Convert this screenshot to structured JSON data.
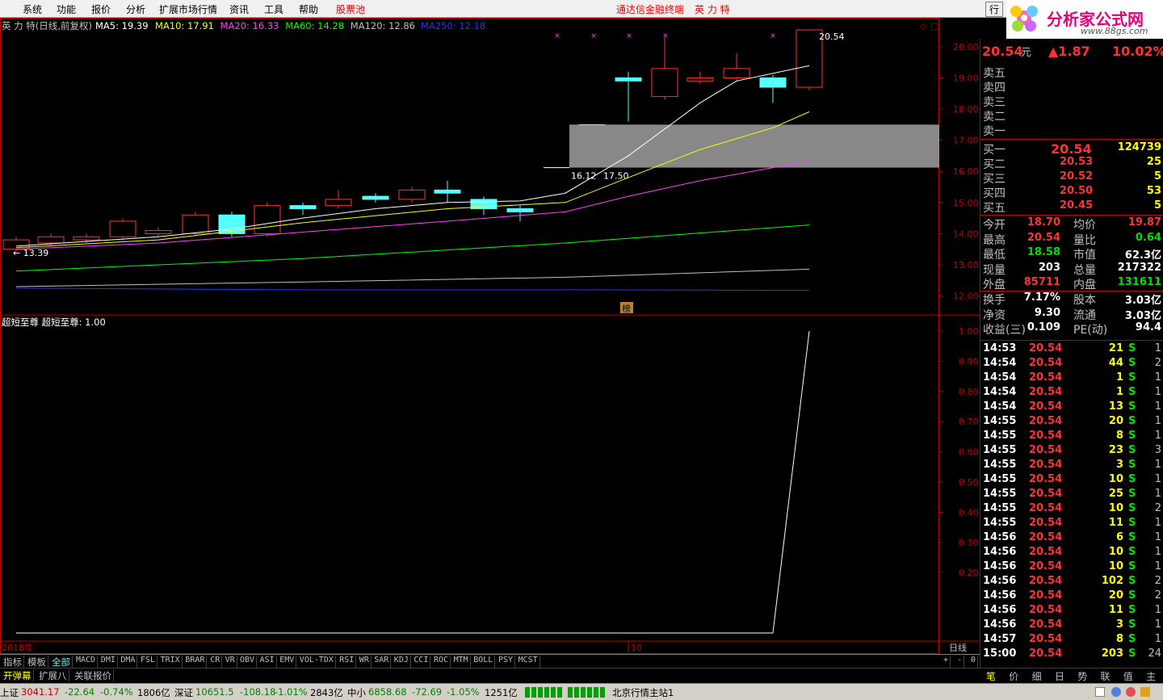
{
  "menu": {
    "items": [
      "系统",
      "功能",
      "报价",
      "分析",
      "扩展市场行情",
      "资讯",
      "工具",
      "帮助"
    ],
    "pool": "股票池",
    "center_title": "通达信金融终端",
    "stock_name": "英 力 特",
    "right_btn": "行"
  },
  "logo": {
    "title": "分析家公式网",
    "url": "www.88gs.com"
  },
  "chart": {
    "header_name": "英 力 特(日线,前复权)",
    "ma": [
      {
        "label": "MA5: 19.39",
        "color": "#ffffff"
      },
      {
        "label": "MA10: 17.91",
        "color": "#ffff00"
      },
      {
        "label": "MA20: 16.33",
        "color": "#ff40ff"
      },
      {
        "label": "MA60: 14.28",
        "color": "#00ff00"
      },
      {
        "label": "MA120: 12.86",
        "color": "#c0c0c0"
      },
      {
        "label": "MA250: 12.18",
        "color": "#3030ff"
      }
    ],
    "price_ticks": [
      "20.00",
      "19.00",
      "18.00",
      "17.00",
      "16.00",
      "15.00",
      "14.00",
      "13.00",
      "12.00"
    ],
    "high_label": "20.54",
    "low_label": "13.39",
    "gap_low": "16.12",
    "gap_high": "17.50",
    "badge": "榜",
    "indicator_header": "超短至尊 超短至尊: 1.00",
    "ind_ticks": [
      "1.00",
      "0.90",
      "0.80",
      "0.70",
      "0.60",
      "0.50",
      "0.40",
      "0.30",
      "0.20"
    ],
    "year_label": "2018年",
    "month_label": "10",
    "period_label": "日线"
  },
  "chart_data": {
    "type": "candlestick",
    "candles": [
      {
        "o": 13.5,
        "c": 13.8,
        "h": 13.9,
        "l": 13.4
      },
      {
        "o": 13.7,
        "c": 13.9,
        "h": 14.0,
        "l": 13.6
      },
      {
        "o": 13.8,
        "c": 13.9,
        "h": 14.0,
        "l": 13.7
      },
      {
        "o": 13.9,
        "c": 14.4,
        "h": 14.5,
        "l": 13.8
      },
      {
        "o": 14.0,
        "c": 14.1,
        "h": 14.2,
        "l": 13.9
      },
      {
        "o": 14.0,
        "c": 14.6,
        "h": 14.7,
        "l": 13.9
      },
      {
        "o": 14.6,
        "c": 14.0,
        "h": 14.7,
        "l": 13.9
      },
      {
        "o": 14.0,
        "c": 14.9,
        "h": 15.0,
        "l": 13.9
      },
      {
        "o": 14.9,
        "c": 14.8,
        "h": 15.0,
        "l": 14.6
      },
      {
        "o": 14.9,
        "c": 15.1,
        "h": 15.4,
        "l": 14.8
      },
      {
        "o": 15.2,
        "c": 15.1,
        "h": 15.3,
        "l": 15.0
      },
      {
        "o": 15.1,
        "c": 15.4,
        "h": 15.5,
        "l": 15.0
      },
      {
        "o": 15.4,
        "c": 15.3,
        "h": 15.7,
        "l": 15.0
      },
      {
        "o": 15.1,
        "c": 14.8,
        "h": 15.2,
        "l": 14.6
      },
      {
        "o": 14.8,
        "c": 14.7,
        "h": 14.9,
        "l": 14.4
      },
      null,
      {
        "o": 16.12,
        "c": 16.12,
        "h": 16.12,
        "l": 16.12
      },
      {
        "o": 17.5,
        "c": 17.5,
        "h": 17.5,
        "l": 17.5
      },
      {
        "o": 19.0,
        "c": 18.9,
        "h": 19.2,
        "l": 17.6
      },
      {
        "o": 18.4,
        "c": 19.3,
        "h": 20.3,
        "l": 18.3
      },
      {
        "o": 18.9,
        "c": 19.0,
        "h": 19.2,
        "l": 18.8
      },
      {
        "o": 19.0,
        "c": 19.3,
        "h": 19.8,
        "l": 18.9
      },
      {
        "o": 19.0,
        "c": 18.7,
        "h": 19.1,
        "l": 18.2
      },
      {
        "o": 18.7,
        "c": 20.54,
        "h": 20.54,
        "l": 18.6
      }
    ],
    "gap": {
      "low": 16.12,
      "high": 17.5
    },
    "ylim": [
      11.6,
      20.8
    ],
    "indicator": {
      "values_flat": 0.0,
      "end_value": 1.0
    }
  },
  "quote": {
    "price": "20.54",
    "unit": "元",
    "change": "▲1.87",
    "pct": "10.02%",
    "sell": [
      "卖五",
      "卖四",
      "卖三",
      "卖二",
      "卖一"
    ],
    "buy": [
      {
        "label": "买一",
        "price": "20.54",
        "vol": "124739"
      },
      {
        "label": "买二",
        "price": "20.53",
        "vol": "25"
      },
      {
        "label": "买三",
        "price": "20.52",
        "vol": "5"
      },
      {
        "label": "买四",
        "price": "20.50",
        "vol": "53"
      },
      {
        "label": "买五",
        "price": "20.45",
        "vol": "5"
      }
    ],
    "stats": [
      {
        "l1": "今开",
        "v1": "18.70",
        "c1": "red",
        "l2": "均价",
        "v2": "19.87",
        "c2": "red"
      },
      {
        "l1": "最高",
        "v1": "20.54",
        "c1": "red",
        "l2": "量比",
        "v2": "0.64",
        "c2": "grn"
      },
      {
        "l1": "最低",
        "v1": "18.58",
        "c1": "grn",
        "l2": "市值",
        "v2": "62.3亿",
        "c2": "wht"
      },
      {
        "l1": "现量",
        "v1": "203",
        "c1": "wht",
        "l2": "总量",
        "v2": "217322",
        "c2": "wht"
      },
      {
        "l1": "外盘",
        "v1": "85711",
        "c1": "red",
        "l2": "内盘",
        "v2": "131611",
        "c2": "grn"
      },
      {
        "l1": "换手",
        "v1": "7.17%",
        "c1": "wht",
        "l2": "股本",
        "v2": "3.03亿",
        "c2": "wht"
      },
      {
        "l1": "净资",
        "v1": "9.30",
        "c1": "wht",
        "l2": "流通",
        "v2": "3.03亿",
        "c2": "wht"
      },
      {
        "l1": "收益(三)",
        "v1": "0.109",
        "c1": "wht",
        "l2": "PE(动)",
        "v2": "94.4",
        "c2": "wht"
      }
    ],
    "ticks": [
      {
        "t": "14:53",
        "p": "20.54",
        "v": "21",
        "n": "1"
      },
      {
        "t": "14:54",
        "p": "20.54",
        "v": "44",
        "n": "2"
      },
      {
        "t": "14:54",
        "p": "20.54",
        "v": "1",
        "n": "1"
      },
      {
        "t": "14:54",
        "p": "20.54",
        "v": "1",
        "n": "1"
      },
      {
        "t": "14:54",
        "p": "20.54",
        "v": "13",
        "n": "1"
      },
      {
        "t": "14:55",
        "p": "20.54",
        "v": "20",
        "n": "1"
      },
      {
        "t": "14:55",
        "p": "20.54",
        "v": "8",
        "n": "1"
      },
      {
        "t": "14:55",
        "p": "20.54",
        "v": "23",
        "n": "3"
      },
      {
        "t": "14:55",
        "p": "20.54",
        "v": "3",
        "n": "1"
      },
      {
        "t": "14:55",
        "p": "20.54",
        "v": "10",
        "n": "1"
      },
      {
        "t": "14:55",
        "p": "20.54",
        "v": "25",
        "n": "1"
      },
      {
        "t": "14:55",
        "p": "20.54",
        "v": "10",
        "n": "2"
      },
      {
        "t": "14:55",
        "p": "20.54",
        "v": "11",
        "n": "1"
      },
      {
        "t": "14:56",
        "p": "20.54",
        "v": "6",
        "n": "1"
      },
      {
        "t": "14:56",
        "p": "20.54",
        "v": "10",
        "n": "1"
      },
      {
        "t": "14:56",
        "p": "20.54",
        "v": "10",
        "n": "1"
      },
      {
        "t": "14:56",
        "p": "20.54",
        "v": "102",
        "n": "2"
      },
      {
        "t": "14:56",
        "p": "20.54",
        "v": "20",
        "n": "2"
      },
      {
        "t": "14:56",
        "p": "20.54",
        "v": "11",
        "n": "1"
      },
      {
        "t": "14:56",
        "p": "20.54",
        "v": "3",
        "n": "1"
      },
      {
        "t": "14:57",
        "p": "20.54",
        "v": "8",
        "n": "1"
      },
      {
        "t": "15:00",
        "p": "20.54",
        "v": "203",
        "n": "24"
      }
    ],
    "side": "S"
  },
  "tabs": [
    "指标",
    "模板",
    "全部",
    "MACD",
    "DMI",
    "DMA",
    "FSL",
    "TRIX",
    "BRAR",
    "CR",
    "VR",
    "OBV",
    "ASI",
    "EMV",
    "VOL-TDX",
    "RSI",
    "WR",
    "SAR",
    "KDJ",
    "CCI",
    "ROC",
    "MTM",
    "BOLL",
    "PSY",
    "MCST"
  ],
  "tabs_active": "全部",
  "tabs_right": [
    "+",
    "-",
    "0"
  ],
  "tabs2": [
    "开弹幕",
    "扩展八",
    "关联报价"
  ],
  "side_tabs": [
    "笔",
    "价",
    "细",
    "日",
    "势",
    "联",
    "值",
    "主"
  ],
  "status": {
    "sh": "上证",
    "sh_val": "3041.17",
    "sh_chg": "-22.64",
    "sh_pct": "-0.74%",
    "sh_amt": "1806亿",
    "sz": "深证",
    "sz_val": "10651.5",
    "sz_chg": "-108.18",
    "sz_pct": "-1.01%",
    "sz_amt": "2843亿",
    "zx": "中小",
    "zx_val": "6858.68",
    "zx_chg": "-72.69",
    "zx_pct": "-1.05%",
    "zx_amt": "1251亿",
    "server": "北京行情主站1"
  }
}
